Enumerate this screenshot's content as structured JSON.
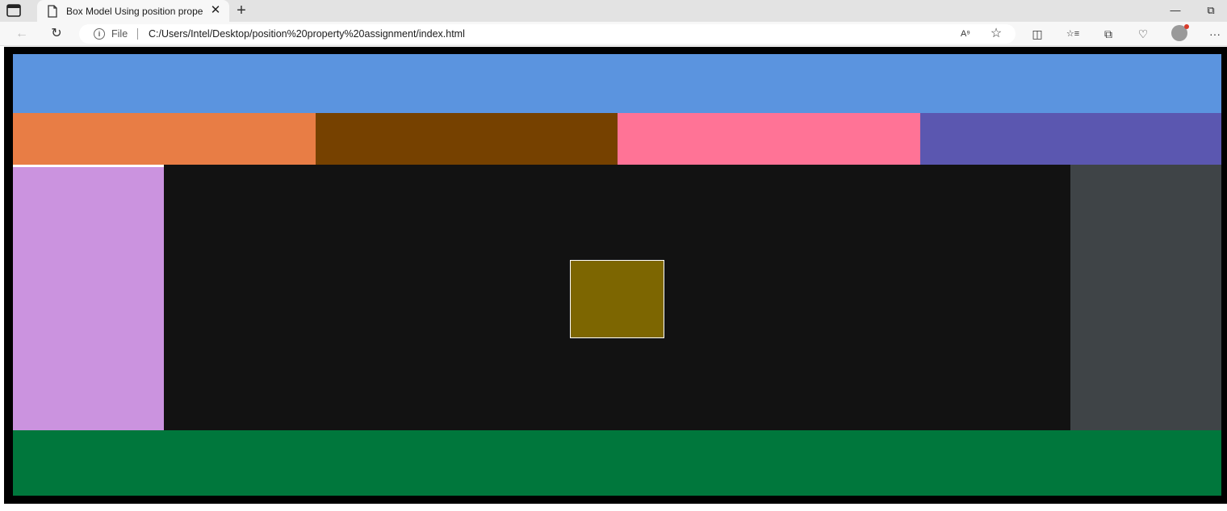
{
  "browser": {
    "tab": {
      "title": "Box Model Using position prope",
      "close_glyph": "✕",
      "icons": {
        "tab_actions": "tab-actions-icon",
        "favicon": "page-icon"
      }
    },
    "new_tab_glyph": "+",
    "window_controls": {
      "minimize": "—",
      "restore": "⧉"
    },
    "nav": {
      "back": "←",
      "refresh": "↻"
    },
    "address": {
      "info_glyph": "i",
      "scheme_label": "File",
      "url": "C:/Users/Intel/Desktop/position%20property%20assignment/index.html"
    },
    "toolbar_icons": {
      "read_aloud": "A⁹",
      "favorite": "☆",
      "split_screen": "◫",
      "favorites": "☆≡",
      "collections": "⧉",
      "browser_essentials": "♡",
      "more": "···"
    }
  },
  "page": {
    "colors": {
      "frame": "#000000",
      "header": "#5b94df",
      "columns": [
        "#e87d45",
        "#764100",
        "#ff7396",
        "#5b57b0"
      ],
      "sidebar_left": "#cb93df",
      "main": "#121212",
      "sidebar_right": "#3f4447",
      "center_box": "#7d6601",
      "footer": "#00773c"
    }
  }
}
